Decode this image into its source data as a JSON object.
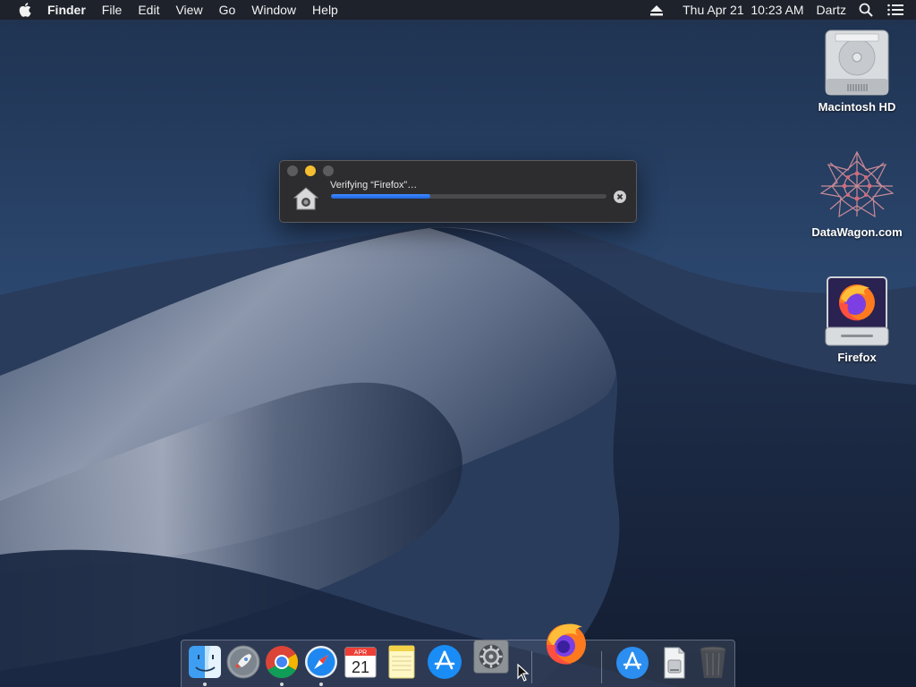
{
  "menubar": {
    "apple_icon": "apple-logo-icon",
    "items": [
      "Finder",
      "File",
      "Edit",
      "View",
      "Go",
      "Window",
      "Help"
    ],
    "clock": "Thu Apr 21  10:23 AM",
    "user": "Dartz",
    "right_icons": [
      "eject-icon",
      "search-icon",
      "list-icon"
    ]
  },
  "desktop_icons": [
    {
      "label": "Macintosh HD",
      "icon": "hard-drive-icon"
    },
    {
      "label": "DataWagon.com",
      "icon": "datawagon-logo-icon"
    },
    {
      "label": "Firefox",
      "icon": "firefox-disk-image-icon"
    }
  ],
  "dialog": {
    "status_text": "Verifying “Firefox”…",
    "progress": 0.36,
    "icon": "home-icon",
    "cancel_icon": "cancel-icon"
  },
  "dock": {
    "items": [
      {
        "name": "finder",
        "running": true
      },
      {
        "name": "launchpad",
        "running": false
      },
      {
        "name": "chrome",
        "running": true
      },
      {
        "name": "safari",
        "running": true
      },
      {
        "name": "calendar",
        "running": false,
        "month": "APR",
        "day": "21"
      },
      {
        "name": "notes",
        "running": false
      },
      {
        "name": "app-store",
        "running": false
      },
      {
        "name": "system-preferences",
        "running": false
      },
      {
        "name": "firefox",
        "running": false
      },
      {
        "name": "applications-folder",
        "running": false
      },
      {
        "name": "downloads-stack",
        "running": false
      },
      {
        "name": "trash",
        "running": false
      }
    ]
  },
  "colors": {
    "menubar_bg": "#1e2026",
    "accent_blue": "#1f64e0",
    "minimize_yellow": "#f5bd31"
  }
}
